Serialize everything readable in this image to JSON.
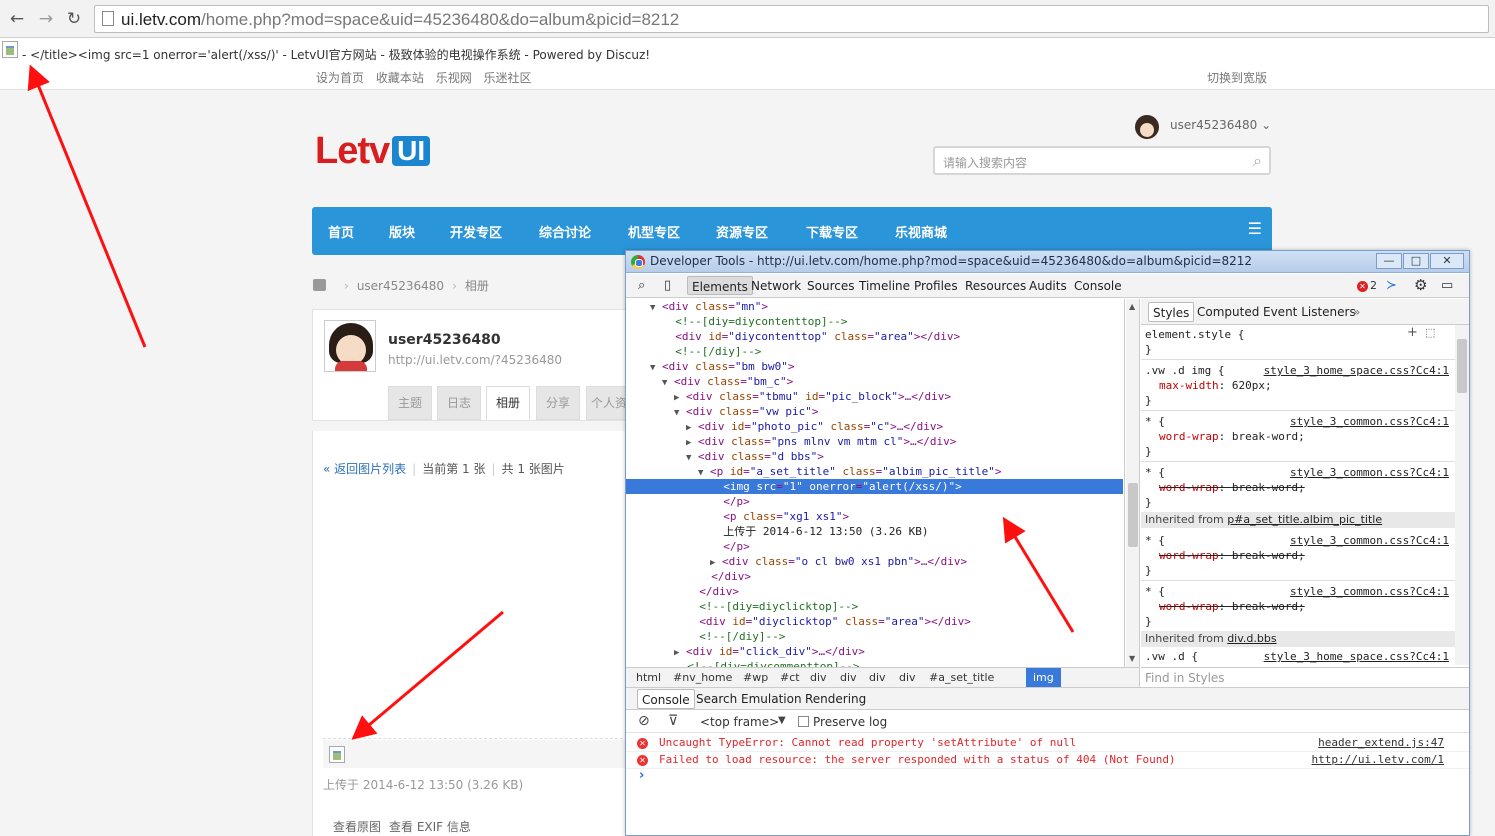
{
  "browser": {
    "url_host": "ui.letv.com",
    "url_path": "/home.php?mod=space&uid=45236480&do=album&picid=8212"
  },
  "page": {
    "title_text": "- </title><img src=1 onerror='alert(/xss/)' - LetvUI官方网站 - 极致体验的电视操作系统 - Powered by Discuz!",
    "top_links": [
      "设为首页",
      "收藏本站",
      "乐视网",
      "乐迷社区"
    ],
    "widescreen": "切换到宽版",
    "logo_main": "Letv",
    "logo_ui": "UI",
    "user_top": "user45236480",
    "search_placeholder": "请输入搜索内容",
    "nav": [
      "首页",
      "版块",
      "开发专区",
      "综合讨论",
      "机型专区",
      "资源专区",
      "下载专区",
      "乐视商城"
    ],
    "breadcrumb": [
      "user45236480",
      "相册"
    ],
    "profile": {
      "name": "user45236480",
      "url": "http://ui.letv.com/?45236480",
      "tabs": [
        "主题",
        "日志",
        "相册",
        "分享",
        "个人资"
      ]
    },
    "album": {
      "back": "« 返回图片列表",
      "current": "当前第 1 张",
      "total": "共 1 张图片"
    },
    "uploaded": "上传于 2014-6-12 13:50 (3.26 KB)",
    "bottom_links": [
      "查看原图",
      "查看 EXIF 信息"
    ]
  },
  "devtools": {
    "title": "Developer Tools - http://ui.letv.com/home.php?mod=space&uid=45236480&do=album&picid=8212",
    "win_buttons": [
      "—",
      "□",
      "✕"
    ],
    "tabs": [
      "Elements",
      "Network",
      "Sources",
      "Timeline",
      "Profiles",
      "Resources",
      "Audits",
      "Console"
    ],
    "error_count": "2",
    "dom": [
      {
        "ind": "▼",
        "html": "<div class=\"mn\">"
      },
      {
        "ind": "",
        "html": "<!--[diy=diycontenttop]-->"
      },
      {
        "ind": "",
        "html": "<div id=\"diycontenttop\" class=\"area\"></div>"
      },
      {
        "ind": "",
        "html": "<!--[/diy]-->"
      },
      {
        "ind": "▼",
        "html": "<div class=\"bm bw0\">"
      },
      {
        "ind": "▼",
        "html": "<div class=\"bm_c\">"
      },
      {
        "ind": "▶",
        "html": "<div class=\"tbmu\" id=\"pic_block\">…</div>"
      },
      {
        "ind": "▼",
        "html": "<div class=\"vw pic\">"
      },
      {
        "ind": "▶",
        "html": "<div id=\"photo_pic\" class=\"c\">…</div>"
      },
      {
        "ind": "▶",
        "html": "<div class=\"pns mlnv vm mtm cl\">…</div>"
      },
      {
        "ind": "▼",
        "html": "<div class=\"d bbs\">"
      },
      {
        "ind": "▼",
        "html": "<p id=\"a_set_title\" class=\"albim_pic_title\">"
      },
      {
        "ind": "",
        "html": "<img src=\"1\" onerror=\"alert(/xss/)\">"
      },
      {
        "ind": "",
        "html": "</p>"
      },
      {
        "ind": "",
        "html": "<p class=\"xg1 xs1\">"
      },
      {
        "ind": "",
        "html": "上传于 2014-6-12 13:50 (3.26 KB)"
      },
      {
        "ind": "",
        "html": "</p>"
      },
      {
        "ind": "▶",
        "html": "<div class=\"o cl bw0 xs1 pbn\">…</div>"
      },
      {
        "ind": "",
        "html": "</div>"
      },
      {
        "ind": "",
        "html": "</div>"
      },
      {
        "ind": "",
        "html": "<!--[diy=diyclicktop]-->"
      },
      {
        "ind": "",
        "html": "<div id=\"diyclicktop\" class=\"area\"></div>"
      },
      {
        "ind": "",
        "html": "<!--[/diy]-->"
      },
      {
        "ind": "▶",
        "html": "<div id=\"click_div\">…</div>"
      },
      {
        "ind": "",
        "html": "<!--[diy=diycommenttop]-->"
      }
    ],
    "path": [
      "html",
      "#nv_home",
      "#wp",
      "#ct",
      "div",
      "div",
      "div",
      "div",
      "#a_set_title",
      "img"
    ],
    "styles_tabs": [
      "Styles",
      "Computed",
      "Event Listeners"
    ],
    "styles": {
      "element_style": "element.style {",
      "rules": [
        {
          "selector": ".vw .d img {",
          "source": "style_3_home_space.css?Cc4:1",
          "prop": "max-width",
          "val": "620px;",
          "strike": false
        },
        {
          "selector": "* {",
          "source": "style_3_common.css?Cc4:1",
          "prop": "word-wrap",
          "val": "break-word;",
          "strike": false
        },
        {
          "selector": "* {",
          "source": "style_3_common.css?Cc4:1",
          "prop": "word-wrap",
          "val": "break-word;",
          "strike": true
        }
      ],
      "inherited1_prefix": "Inherited from ",
      "inherited1": "p#a_set_title.albim_pic_title",
      "rules2": [
        {
          "selector": "* {",
          "source": "style_3_common.css?Cc4:1",
          "prop": "word-wrap",
          "val": "break-word;",
          "strike": true
        },
        {
          "selector": "* {",
          "source": "style_3_common.css?Cc4:1",
          "prop": "word-wrap",
          "val": "break-word;",
          "strike": true
        }
      ],
      "inherited2": "div.d.bbs",
      "last_selector": ".vw .d {",
      "last_source": "style_3_home_space.css?Cc4:1",
      "find_placeholder": "Find in Styles"
    },
    "console_tabs": [
      "Console",
      "Search",
      "Emulation",
      "Rendering"
    ],
    "top_frame": "<top frame>",
    "preserve_log": "Preserve log",
    "messages": [
      {
        "text": "Uncaught TypeError: Cannot read property 'setAttribute' of null",
        "source": "header_extend.js:47"
      },
      {
        "text": "Failed to load resource: the server responded with a status of 404 (Not Found)",
        "source": "http://ui.letv.com/1"
      }
    ]
  },
  "colors": {
    "nav_blue": "#2b95d9",
    "logo_red": "#d81e1e",
    "selection_blue": "#3879d9",
    "error_red": "#e0262c",
    "arrow_red": "#ff1010"
  }
}
